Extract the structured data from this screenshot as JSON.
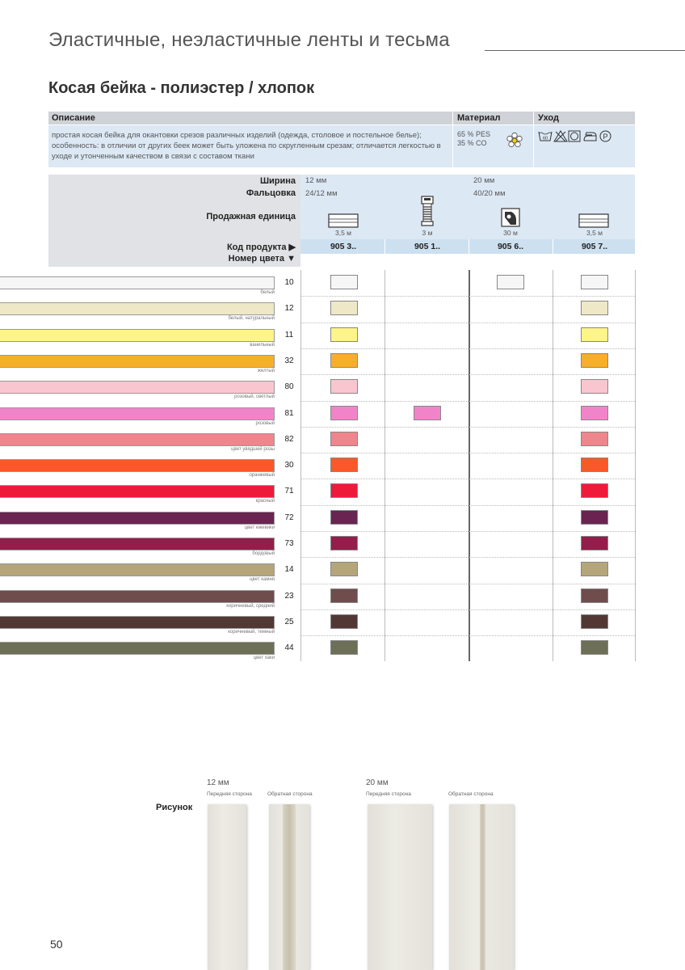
{
  "header": {
    "title": "Эластичные, неэластичные ленты и тесьма"
  },
  "section": {
    "title": "Косая бейка - полиэстер / хлопок"
  },
  "info": {
    "desc_label": "Описание",
    "material_label": "Материал",
    "care_label": "Уход",
    "description": "простая косая бейка для окантовки срезов различных изделий (одежда, столовое и постельное белье); особенность: в отличии от других беек может быть уложена по скругленным срезам; отличается легкостью в уходе и утонченным качеством в связи с составом ткани",
    "material_1": "65 % PES",
    "material_2": "35 % CO",
    "care_icons": [
      "wash-60-icon",
      "no-bleach-icon",
      "tumble-dry-icon",
      "iron-icon",
      "dry-clean-p-icon"
    ],
    "wash_temp": "60",
    "dryclean_letter": "P"
  },
  "spec": {
    "width_label": "Ширина",
    "fold_label": "Фальцовка",
    "unit_label": "Продажная единица",
    "code_label": "Код продукта ▶",
    "color_label": "Номер цвета ▼",
    "width_12": "12 мм",
    "width_20": "20 мм",
    "fold_12": "24/12 мм",
    "fold_20": "40/20 мм",
    "columns": [
      {
        "length": "3,5 м",
        "code": "905 3..",
        "icon": "card-icon"
      },
      {
        "length": "3 м",
        "code": "905 1..",
        "icon": "spool-icon"
      },
      {
        "length": "30 м",
        "code": "905 6..",
        "icon": "roll-icon"
      },
      {
        "length": "3,5 м",
        "code": "905 7..",
        "icon": "card-icon"
      }
    ]
  },
  "colors": [
    {
      "num": "10",
      "name": "белый",
      "hex": "#f6f6f6",
      "avail": [
        true,
        false,
        true,
        true
      ]
    },
    {
      "num": "12",
      "name": "белый, натуральный",
      "hex": "#efe8c6",
      "avail": [
        true,
        false,
        false,
        true
      ]
    },
    {
      "num": "11",
      "name": "ванильный",
      "hex": "#fdf48a",
      "avail": [
        true,
        false,
        false,
        true
      ]
    },
    {
      "num": "32",
      "name": "желтый",
      "hex": "#f8ae2d",
      "avail": [
        true,
        false,
        false,
        true
      ]
    },
    {
      "num": "80",
      "name": "розовый, светлый",
      "hex": "#f9c6d0",
      "avail": [
        true,
        false,
        false,
        true
      ]
    },
    {
      "num": "81",
      "name": "розовый",
      "hex": "#f184c8",
      "avail": [
        true,
        true,
        false,
        true
      ]
    },
    {
      "num": "82",
      "name": "цвет увядшей розы",
      "hex": "#ef858d",
      "avail": [
        true,
        false,
        false,
        true
      ]
    },
    {
      "num": "30",
      "name": "оранжевый",
      "hex": "#f75a27",
      "avail": [
        true,
        false,
        false,
        true
      ]
    },
    {
      "num": "71",
      "name": "красный",
      "hex": "#ee1a3a",
      "avail": [
        true,
        false,
        false,
        true
      ]
    },
    {
      "num": "72",
      "name": "цвет ежевики",
      "hex": "#692452",
      "avail": [
        true,
        false,
        false,
        true
      ]
    },
    {
      "num": "73",
      "name": "бордовый",
      "hex": "#931e4b",
      "avail": [
        true,
        false,
        false,
        true
      ]
    },
    {
      "num": "14",
      "name": "цвет камня",
      "hex": "#b5a57a",
      "avail": [
        true,
        false,
        false,
        true
      ]
    },
    {
      "num": "23",
      "name": "коричневый, средний",
      "hex": "#6f4d4c",
      "avail": [
        true,
        false,
        false,
        true
      ]
    },
    {
      "num": "25",
      "name": "коричневый, темный",
      "hex": "#523834",
      "avail": [
        true,
        false,
        false,
        true
      ]
    },
    {
      "num": "44",
      "name": "цвет хаки",
      "hex": "#6e6f57",
      "avail": [
        true,
        false,
        false,
        true
      ]
    }
  ],
  "figure": {
    "label": "Рисунок",
    "width_12": "12 мм",
    "width_20": "20 мм",
    "front": "Передняя сторона",
    "back": "Обратная сторона"
  },
  "page_number": "50"
}
